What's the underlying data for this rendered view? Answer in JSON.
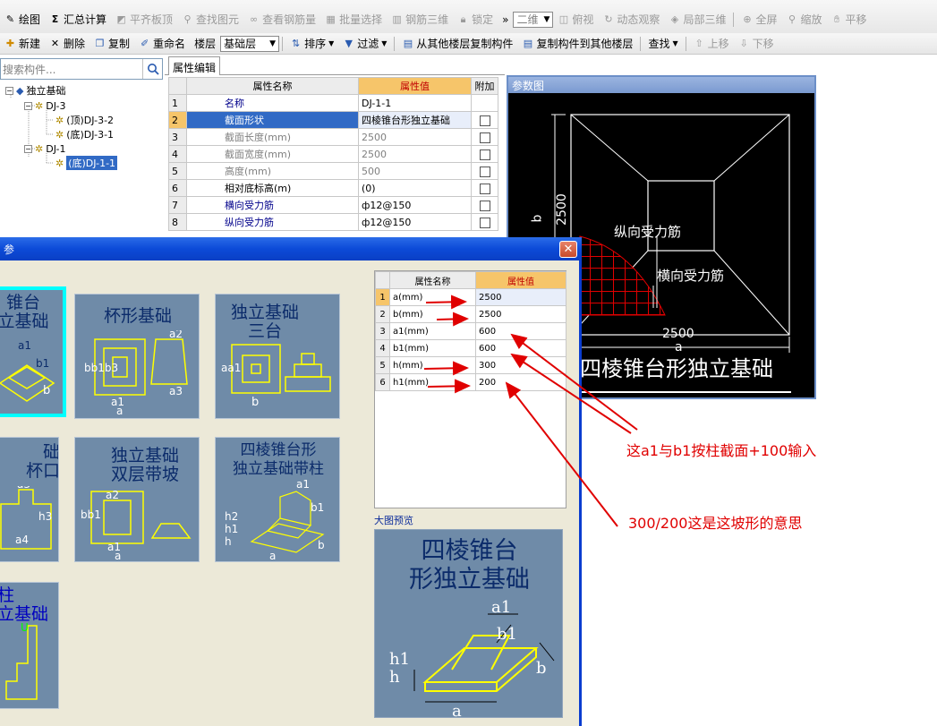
{
  "toolbar1": {
    "draw": "绘图",
    "sum_calc": "汇总计算",
    "flush_slab": "平齐板顶",
    "find_element": "查找图元",
    "view_rebar": "查看钢筋量",
    "batch_select": "批量选择",
    "rebar_3d": "钢筋三维",
    "lock": "锁定",
    "more": "»",
    "view_mode": "二维",
    "top_view": "俯视",
    "dynamic_view": "动态观察",
    "local_3d": "局部三维",
    "fullscreen": "全屏",
    "zoom": "缩放",
    "pan": "平移"
  },
  "toolbar2": {
    "new": "新建",
    "delete": "删除",
    "copy": "复制",
    "rename": "重命名",
    "floor_label": "楼层",
    "floor_value": "基础层",
    "sort": "排序",
    "filter": "过滤",
    "copy_from_other": "从其他楼层复制构件",
    "copy_to_other": "复制构件到其他楼层",
    "find": "查找",
    "move_up": "上移",
    "move_down": "下移"
  },
  "search": {
    "placeholder": "搜索构件..."
  },
  "tree": {
    "root": "独立基础",
    "dj3": "DJ-3",
    "dj3_top": "(顶)DJ-3-2",
    "dj3_bottom": "(底)DJ-3-1",
    "dj1": "DJ-1",
    "dj1_bottom": "(底)DJ-1-1"
  },
  "props": {
    "tab": "属性编辑",
    "col_name": "属性名称",
    "col_value": "属性值",
    "col_extra": "附加",
    "rows": [
      {
        "n": "1",
        "name": "名称",
        "value": "DJ-1-1"
      },
      {
        "n": "2",
        "name": "截面形状",
        "value": "四棱锥台形独立基础"
      },
      {
        "n": "3",
        "name": "截面长度(mm)",
        "value": "2500"
      },
      {
        "n": "4",
        "name": "截面宽度(mm)",
        "value": "2500"
      },
      {
        "n": "5",
        "name": "高度(mm)",
        "value": "500"
      },
      {
        "n": "6",
        "name": "相对底标高(m)",
        "value": "(0)"
      },
      {
        "n": "7",
        "name": "横向受力筋",
        "value": "ф12@150"
      },
      {
        "n": "8",
        "name": "纵向受力筋",
        "value": "ф12@150"
      }
    ]
  },
  "reference": {
    "header": "参数图",
    "label_b": "b",
    "dim_b": "2500",
    "label_long": "纵向受力筋",
    "label_trans": "横向受力筋",
    "dim_a": "2500",
    "label_a": "a",
    "caption": "四棱锥台形独立基础"
  },
  "dialog": {
    "title": "参",
    "close": "✕",
    "tiles": [
      {
        "title": "锥台\n立基础"
      },
      {
        "title": "杯形基础"
      },
      {
        "title": "独立基础\n三台"
      },
      {
        "title": "础\n杯口"
      },
      {
        "title": "独立基础\n双层带坡"
      },
      {
        "title": "四棱锥台形\n独立基础带柱"
      },
      {
        "title": "柱\n立基础"
      }
    ],
    "params": {
      "col_name": "属性名称",
      "col_value": "属性值",
      "rows": [
        {
          "n": "1",
          "name": "a(mm)",
          "value": "2500"
        },
        {
          "n": "2",
          "name": "b(mm)",
          "value": "2500"
        },
        {
          "n": "3",
          "name": "a1(mm)",
          "value": "600"
        },
        {
          "n": "4",
          "name": "b1(mm)",
          "value": "600"
        },
        {
          "n": "5",
          "name": "h(mm)",
          "value": "300"
        },
        {
          "n": "6",
          "name": "h1(mm)",
          "value": "200"
        }
      ]
    },
    "preview_label": "大图预览",
    "preview_title": "四棱锥台\n形独立基础"
  },
  "notes": {
    "note1": "这a1与b1按柱截面+100输入",
    "note2": "300/200这是这坡形的意思"
  },
  "colors": {
    "accent_red": "#e00000",
    "selection": "#316ac5",
    "header_orange": "#f6c56a",
    "tile_bg": "#6f8ba8",
    "title_blue": "#0c4ad8"
  }
}
